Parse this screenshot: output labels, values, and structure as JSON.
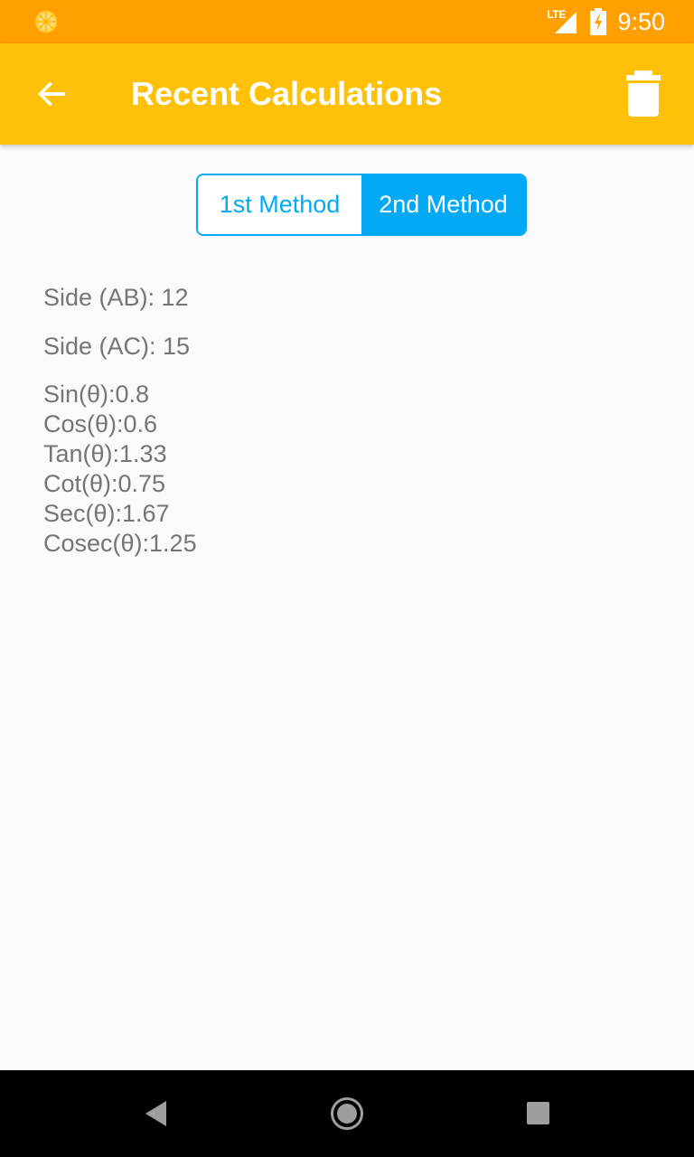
{
  "status_bar": {
    "network": "LTE",
    "time": "9:50"
  },
  "app_bar": {
    "title": "Recent Calculations",
    "back_icon": "arrow-back-icon",
    "delete_icon": "trash-icon"
  },
  "method_toggle": {
    "options": [
      "1st Method",
      "2nd Method"
    ],
    "selected": "2nd Method"
  },
  "inputs": {
    "side_ab": "Side (AB): 12",
    "side_ac": "Side (AC): 15"
  },
  "results": [
    "Sin(θ):0.8",
    "Cos(θ):0.6",
    "Tan(θ):1.33",
    "Cot(θ):0.75",
    "Sec(θ):1.67",
    "Cosec(θ):1.25"
  ],
  "colors": {
    "status_bar": "#ffa000",
    "app_bar": "#ffc107",
    "accent": "#03a9f4",
    "text": "#757575",
    "background": "#fafafa"
  },
  "nav_bar": {
    "icons": [
      "nav-back-icon",
      "nav-home-icon",
      "nav-recents-icon"
    ]
  }
}
